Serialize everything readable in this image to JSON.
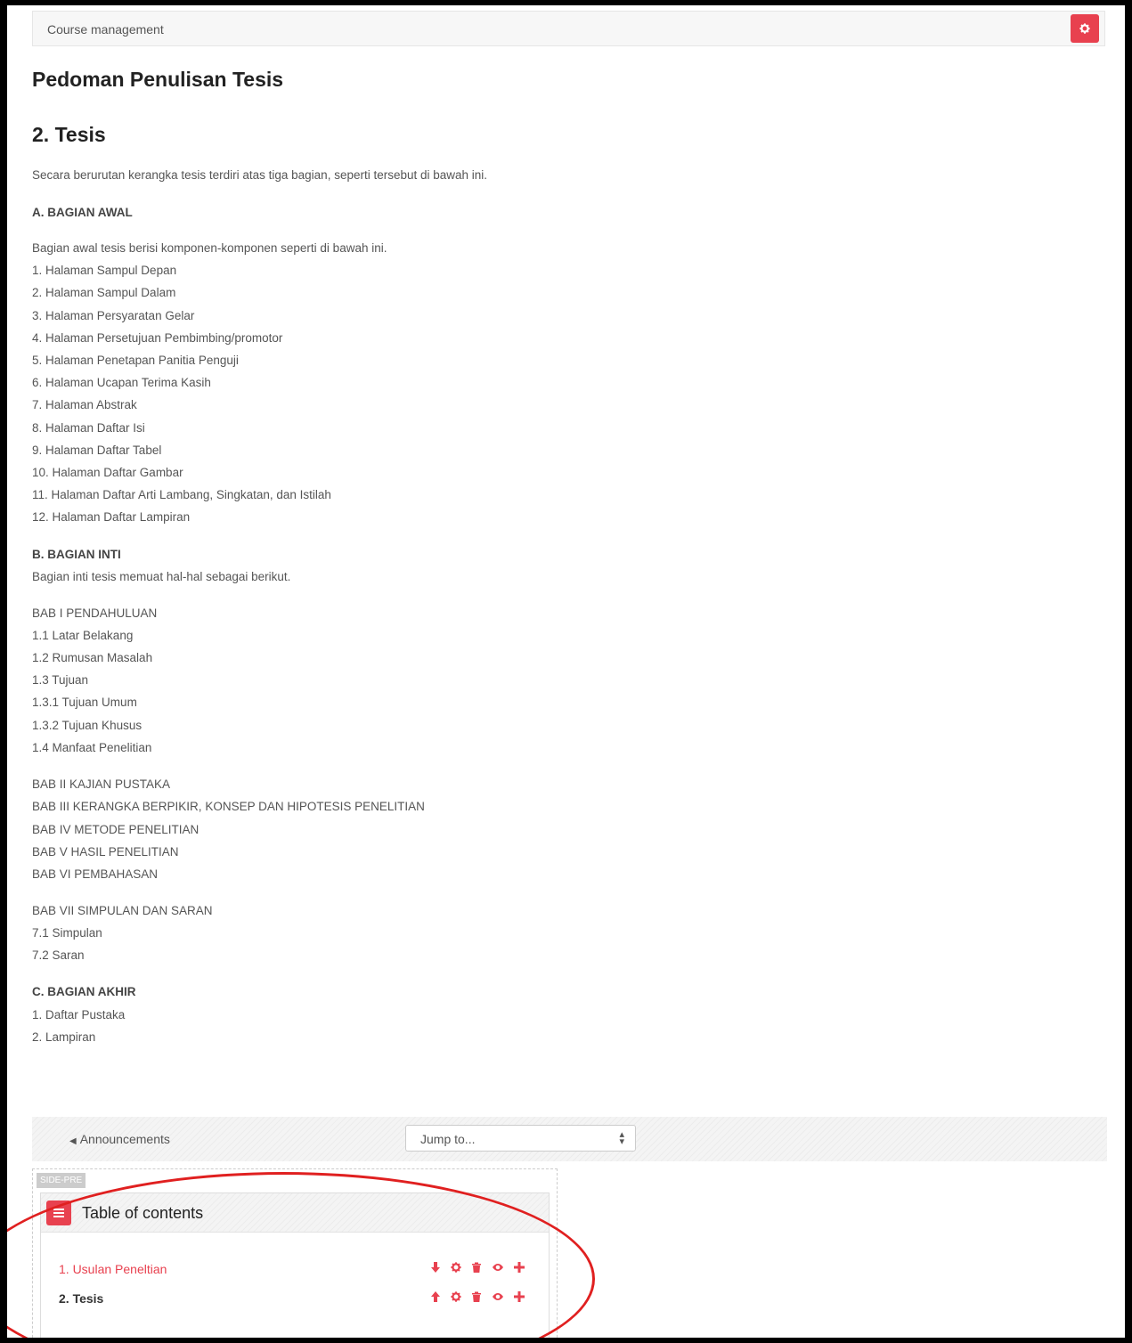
{
  "header": {
    "breadcrumb": "Course management",
    "settings_icon": "gear-icon",
    "accent_color": "#e8414f"
  },
  "page_title": "Pedoman Penulisan Tesis",
  "section_title": "2. Tesis",
  "content": {
    "intro": "Secara berurutan kerangka tesis terdiri atas tiga bagian, seperti tersebut di bawah ini.",
    "part_a_heading": "A. BAGIAN AWAL",
    "part_a_intro": "Bagian awal tesis berisi komponen-komponen seperti di bawah ini.",
    "part_a_items": [
      "1. Halaman Sampul Depan",
      "2. Halaman Sampul Dalam",
      "3. Halaman Persyaratan Gelar",
      "4. Halaman Persetujuan Pembimbing/promotor",
      "5. Halaman Penetapan Panitia Penguji",
      "6. Halaman Ucapan Terima Kasih",
      "7. Halaman Abstrak",
      "8. Halaman Daftar Isi",
      "9. Halaman Daftar Tabel",
      "10. Halaman Daftar Gambar",
      "11. Halaman Daftar Arti Lambang, Singkatan, dan Istilah",
      "12. Halaman Daftar Lampiran"
    ],
    "part_b_heading": "B. BAGIAN INTI",
    "part_b_intro": "Bagian inti tesis memuat hal-hal sebagai berikut.",
    "bab1": [
      "BAB I PENDAHULUAN",
      "1.1 Latar Belakang",
      "1.2 Rumusan Masalah",
      "1.3 Tujuan",
      "1.3.1 Tujuan Umum",
      "1.3.2 Tujuan Khusus",
      "1.4 Manfaat Penelitian"
    ],
    "bab2to6": [
      "BAB II KAJIAN PUSTAKA",
      "BAB III KERANGKA BERPIKIR, KONSEP DAN HIPOTESIS PENELITIAN",
      "BAB IV METODE PENELITIAN",
      "BAB V HASIL PENELITIAN",
      "BAB VI PEMBAHASAN"
    ],
    "bab7": [
      "BAB VII SIMPULAN DAN SARAN",
      "7.1 Simpulan",
      "7.2 Saran"
    ],
    "part_c_heading": "C. BAGIAN AKHIR",
    "part_c_items": [
      "1. Daftar Pustaka",
      "2. Lampiran"
    ]
  },
  "navigation": {
    "prev_link": "Announcements",
    "jump_placeholder": "Jump to..."
  },
  "side_region": {
    "tag": "SIDE-PRE",
    "block_title": "Table of contents",
    "items": [
      {
        "label": "1. Usulan Peneltian",
        "state": "link",
        "actions": [
          "arrow-down-icon",
          "gear-icon",
          "trash-icon",
          "eye-icon",
          "plus-icon"
        ]
      },
      {
        "label": "2. Tesis",
        "state": "current",
        "actions": [
          "arrow-up-icon",
          "gear-icon",
          "trash-icon",
          "eye-icon",
          "plus-icon"
        ]
      }
    ]
  },
  "annotation_color": "#e02020"
}
